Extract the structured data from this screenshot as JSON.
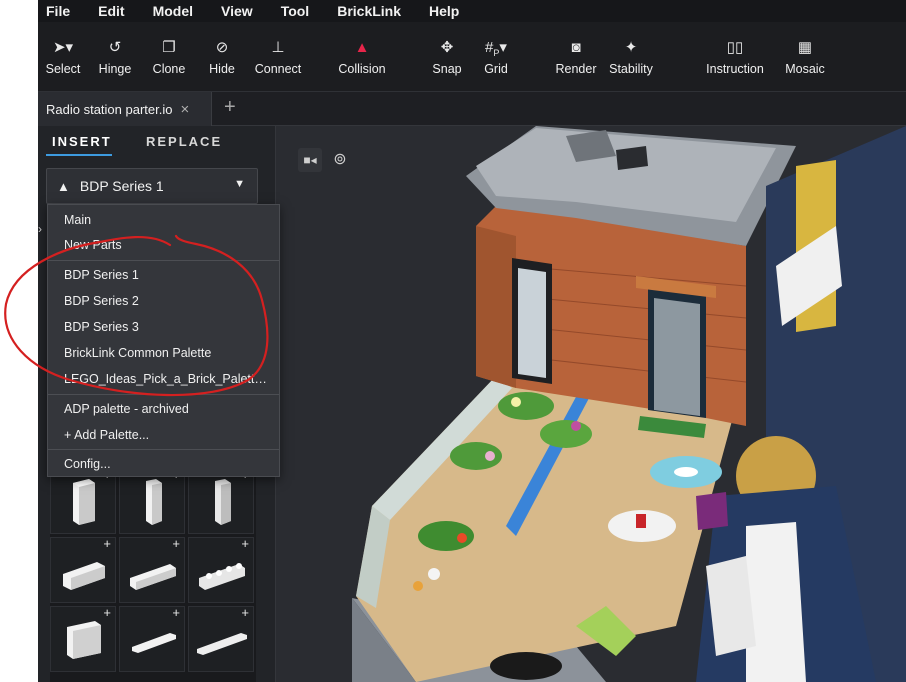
{
  "menubar": {
    "items": [
      "File",
      "Edit",
      "Model",
      "View",
      "Tool",
      "BrickLink",
      "Help"
    ]
  },
  "toolbar": {
    "tools": [
      {
        "label": "Select",
        "icon": "cursor-icon"
      },
      {
        "label": "Hinge",
        "icon": "hinge-icon"
      },
      {
        "label": "Clone",
        "icon": "clone-icon"
      },
      {
        "label": "Hide",
        "icon": "eye-slash-icon"
      },
      {
        "label": "Connect",
        "icon": "connect-icon"
      },
      {
        "label": "Collision",
        "icon": "warning-icon"
      },
      {
        "label": "Snap",
        "icon": "snap-icon"
      },
      {
        "label": "Grid",
        "icon": "grid-icon"
      },
      {
        "label": "Render",
        "icon": "camera-icon"
      },
      {
        "label": "Stability",
        "icon": "stability-icon"
      },
      {
        "label": "Instruction",
        "icon": "book-icon"
      },
      {
        "label": "Mosaic",
        "icon": "mosaic-icon"
      }
    ],
    "collision_color": "#e8254a",
    "grid_badge": "P"
  },
  "tabs": {
    "active": "Radio station parter.io",
    "close_glyph": "×",
    "new_tab_glyph": "+"
  },
  "panel": {
    "tab_insert": "INSERT",
    "tab_replace": "REPLACE",
    "accent_color": "#3d9be0",
    "palette_selected": "BDP Series 1"
  },
  "dropdown": {
    "groups": [
      [
        "Main",
        "New Parts"
      ],
      [
        "BDP Series 1",
        "BDP Series 2",
        "BDP Series 3",
        "BrickLink Common Palette",
        "LEGO_Ideas_Pick_a_Brick_Palette_..."
      ],
      [
        "ADP palette - archived",
        "+ Add Palette..."
      ],
      [
        "Config..."
      ]
    ]
  },
  "bricks": {
    "add_glyph": "+"
  },
  "viewport": {
    "camera_icon": "camera-icon",
    "orbit_icon": "orbit-icon"
  },
  "annotation": {
    "color": "#d42020"
  }
}
